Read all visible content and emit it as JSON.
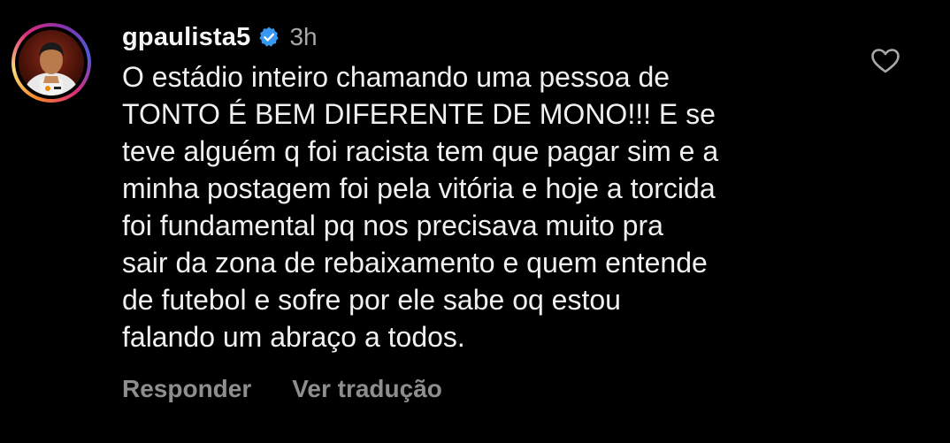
{
  "comment": {
    "username": "gpaulista5",
    "time": "3h",
    "text": "O estádio inteiro chamando uma pessoa de\nTONTO É BEM DIFERENTE DE MONO!!! E se\nteve alguém q foi racista tem que pagar sim e a\nminha postagem foi pela vitória e hoje a torcida\nfoi fundamental pq nos precisava muito pra\nsair da zona de rebaixamento e quem entende\nde futebol e sofre por ele sabe oq estou\nfalando um abraço a todos.",
    "reply_label": "Responder",
    "translate_label": "Ver tradução"
  },
  "icons": {
    "verified": "verified-badge-icon",
    "like": "heart-outline-icon"
  },
  "colors": {
    "background": "#000000",
    "text": "#f5f5f5",
    "muted": "#a8a8a8",
    "verified": "#3897f0"
  }
}
